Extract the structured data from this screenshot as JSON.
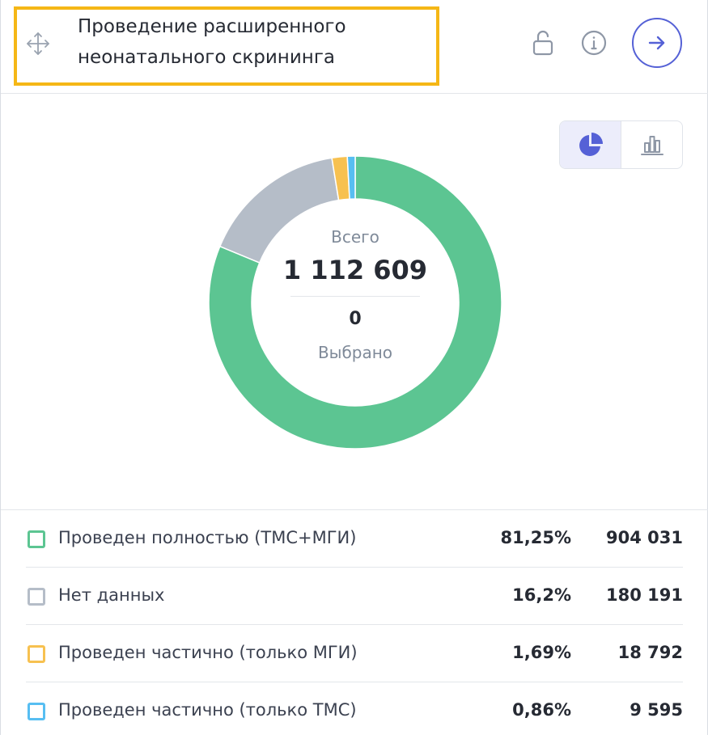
{
  "header": {
    "title": "Проведение расширенного неонатального скрининга",
    "icons": {
      "drag": "move-icon",
      "lock": "unlock-icon",
      "info": "info-icon",
      "go": "arrow-right-icon"
    }
  },
  "chart_toggle": {
    "options": [
      "pie-chart-icon",
      "bar-chart-icon"
    ],
    "selected": "pie-chart-icon"
  },
  "colors": {
    "accent": "#5561d6",
    "highlight": "#f5b716"
  },
  "summary": {
    "total_label": "Всего",
    "total_value": "1 112 609",
    "selected_value": "0",
    "selected_label": "Выбрано"
  },
  "chart_data": {
    "type": "pie",
    "donut": true,
    "categories": [
      "Проведен полностью (ТМС+МГИ)",
      "Нет данных",
      "Проведен частично (только МГИ)",
      "Проведен частично (только ТМС)"
    ],
    "values": [
      904031,
      180191,
      18792,
      9595
    ],
    "colors": [
      "#5cc592",
      "#b5bdc8",
      "#f7c150",
      "#57bef2"
    ]
  },
  "legend": [
    {
      "label": "Проведен полностью (ТМС+МГИ)",
      "percent": "81,25%",
      "value": "904 031",
      "color": "#5cc592"
    },
    {
      "label": "Нет данных",
      "percent": "16,2%",
      "value": "180 191",
      "color": "#b5bdc8"
    },
    {
      "label": "Проведен частично (только МГИ)",
      "percent": "1,69%",
      "value": "18 792",
      "color": "#f7c150"
    },
    {
      "label": "Проведен частично (только ТМС)",
      "percent": "0,86%",
      "value": "9 595",
      "color": "#57bef2"
    }
  ]
}
